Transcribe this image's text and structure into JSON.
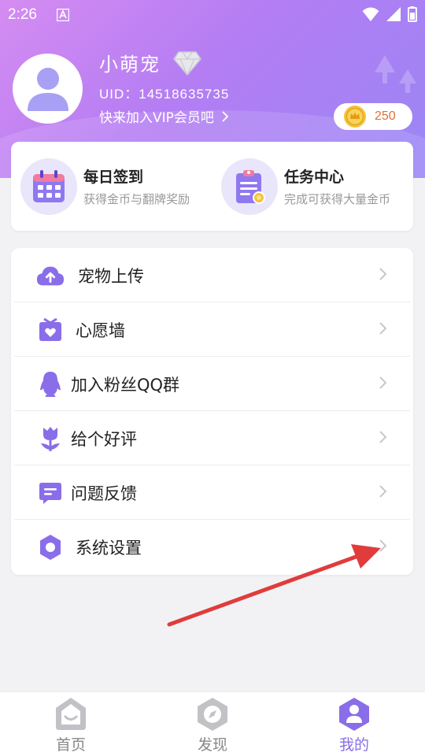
{
  "status_bar": {
    "time": "2:26"
  },
  "profile": {
    "name": "小萌宠",
    "uid": "UID：14518635735",
    "vip_link": "快来加入VIP会员吧",
    "coins": "250"
  },
  "tasks": [
    {
      "title": "每日签到",
      "subtitle": "获得金币与翻牌奖励"
    },
    {
      "title": "任务中心",
      "subtitle": "完成可获得大量金币"
    }
  ],
  "menu": [
    {
      "label": "宠物上传",
      "icon": "cloud-upload-icon"
    },
    {
      "label": "心愿墙",
      "icon": "gift-heart-icon"
    },
    {
      "label": "加入粉丝QQ群",
      "icon": "qq-penguin-icon"
    },
    {
      "label": "给个好评",
      "icon": "tulip-icon"
    },
    {
      "label": "问题反馈",
      "icon": "message-icon"
    },
    {
      "label": "系统设置",
      "icon": "gear-icon"
    }
  ],
  "tabs": [
    {
      "label": "首页",
      "icon": "home-icon"
    },
    {
      "label": "发现",
      "icon": "compass-icon"
    },
    {
      "label": "我的",
      "icon": "profile-icon",
      "active": true
    }
  ],
  "colors": {
    "accent": "#8a6de9",
    "coin": "#e0703a"
  }
}
